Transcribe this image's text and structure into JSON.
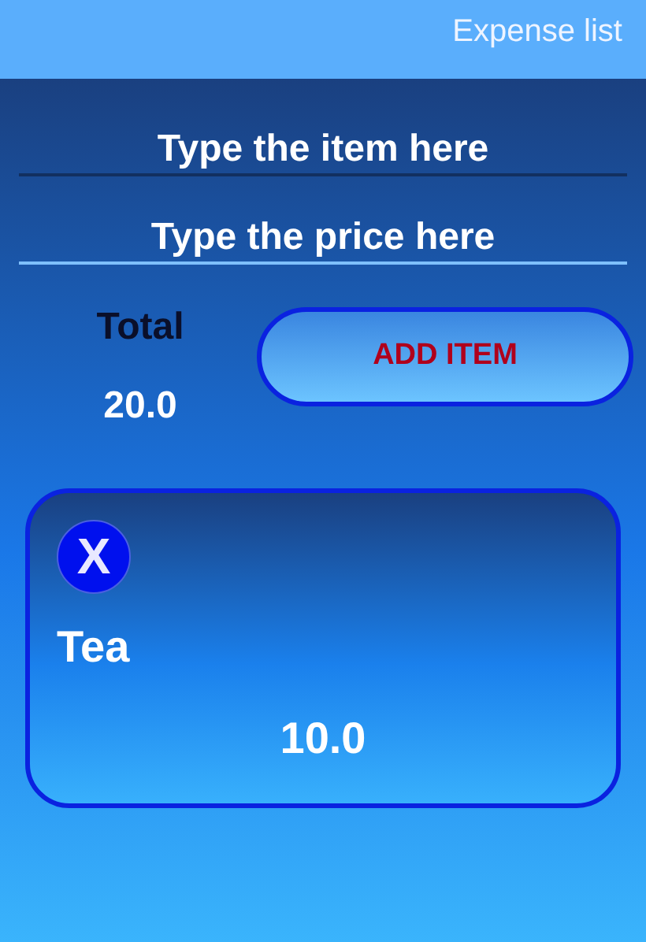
{
  "app_bar": {
    "title": "Expense list"
  },
  "fields": [
    {
      "placeholder": "Type the item here",
      "focused": true
    },
    {
      "placeholder": "Type the price here",
      "focused": false
    }
  ],
  "total": {
    "label": "Total",
    "value": "20.0"
  },
  "add_button": {
    "label": "ADD ITEM"
  },
  "items": [
    {
      "delete": "X",
      "name": "Tea",
      "price": "10.0"
    }
  ]
}
